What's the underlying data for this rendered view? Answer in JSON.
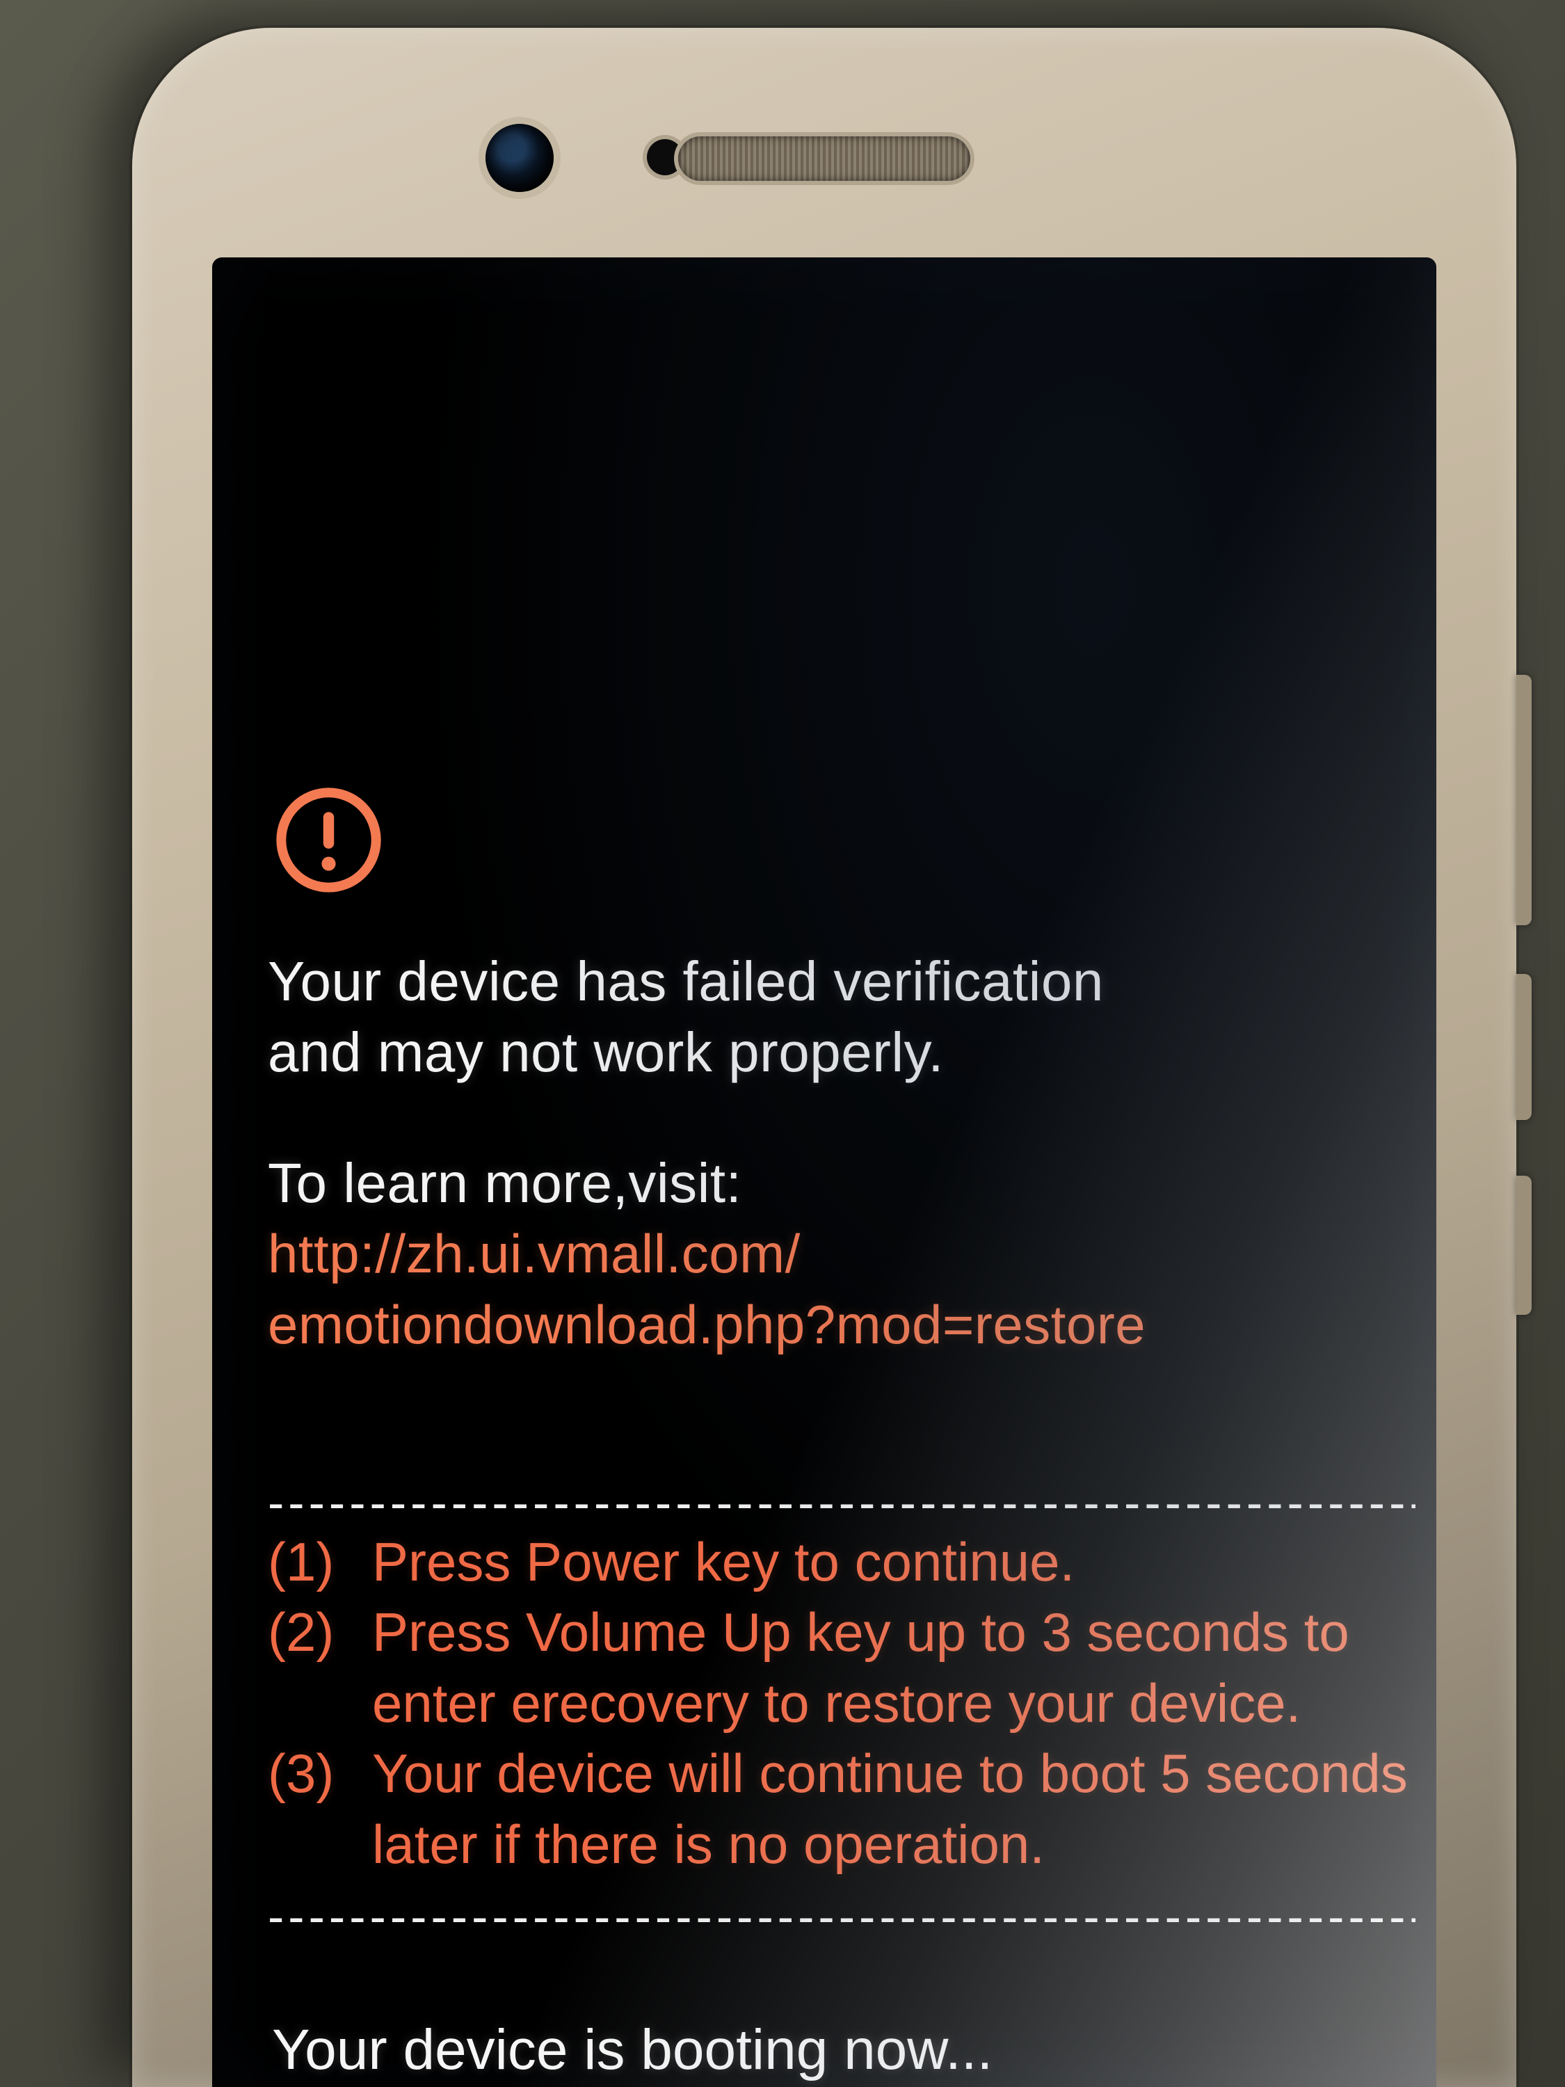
{
  "colors": {
    "accent": "#f47a52",
    "text": "#f4f4f4",
    "screen_bg": "#000000"
  },
  "warning": {
    "icon": "warning-icon",
    "headline_l1": "Your device has failed verification",
    "headline_l2": "and may not work properly.",
    "learn_more_label": "To learn more,visit:",
    "url_l1": "http://zh.ui.vmall.com/",
    "url_l2": "emotiondownload.php?mod=restore"
  },
  "divider": "-----------------------------------------------------------",
  "steps": [
    {
      "num": "(1)",
      "text": "Press Power key to continue."
    },
    {
      "num": "(2)",
      "text": "Press Volume Up key up to 3 seconds to enter erecovery to restore your device."
    },
    {
      "num": "(3)",
      "text": "Your device will continue to boot 5 seconds later if there is no operation."
    }
  ],
  "booting": "Your device is booting now..."
}
